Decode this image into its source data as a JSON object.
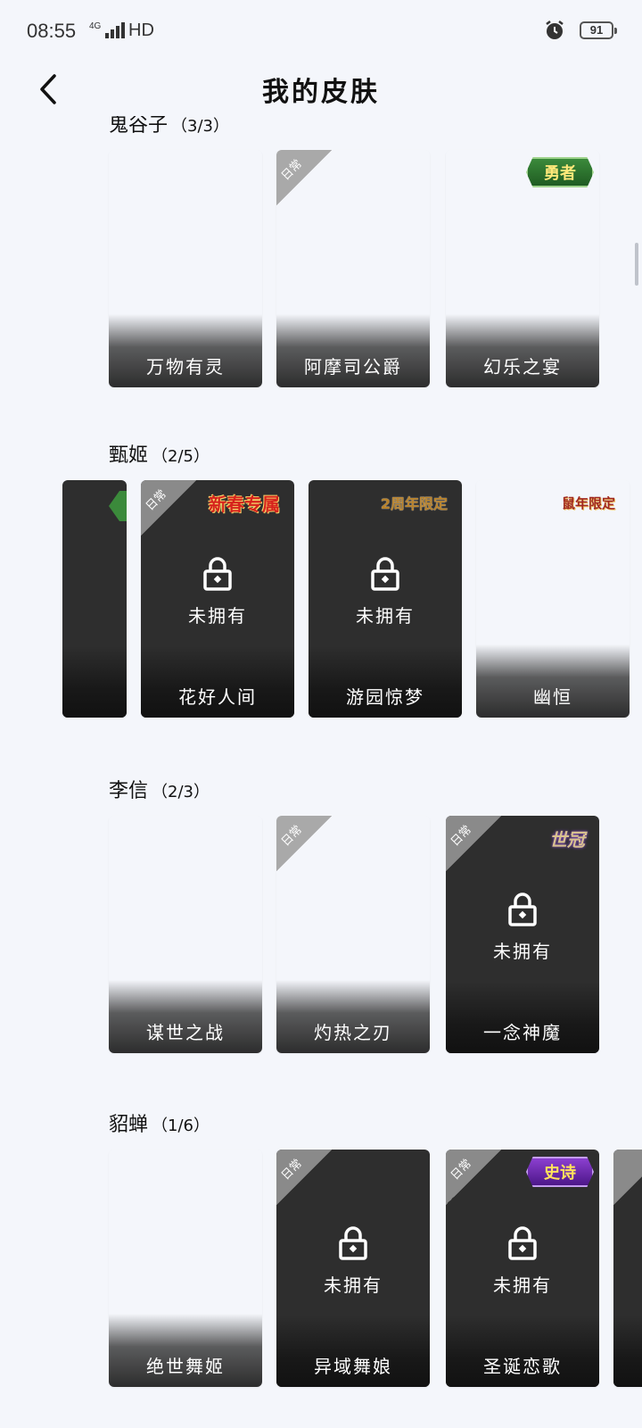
{
  "status_bar": {
    "time": "08:55",
    "network": "4G",
    "hd": "HD",
    "battery": "91"
  },
  "header": {
    "title": "我的皮肤"
  },
  "sections": [
    {
      "hero": "鬼谷子",
      "count": "（3/3）",
      "cards": [
        {
          "name": "万物有灵",
          "daily": false,
          "locked": false,
          "badge": ""
        },
        {
          "name": "阿摩司公爵",
          "daily": true,
          "locked": false,
          "badge": ""
        },
        {
          "name": "幻乐之宴",
          "daily": false,
          "locked": false,
          "badge": "勇者"
        }
      ]
    },
    {
      "hero": "甄姬",
      "count": "（2/5）",
      "cards": [
        {
          "name": "花好人间",
          "daily": true,
          "locked": true,
          "badge": "新春专属"
        },
        {
          "name": "游园惊梦",
          "daily": false,
          "locked": true,
          "badge": "2周年限定"
        },
        {
          "name": "幽恒",
          "daily": false,
          "locked": false,
          "badge": "鼠年限定"
        }
      ]
    },
    {
      "hero": "李信",
      "count": "（2/3）",
      "cards": [
        {
          "name": "谋世之战",
          "daily": false,
          "locked": false,
          "badge": ""
        },
        {
          "name": "灼热之刃",
          "daily": true,
          "locked": false,
          "badge": ""
        },
        {
          "name": "一念神魔",
          "daily": true,
          "locked": true,
          "badge": "世冠"
        }
      ]
    },
    {
      "hero": "貂蝉",
      "count": "（1/6）",
      "cards": [
        {
          "name": "绝世舞姬",
          "daily": false,
          "locked": false,
          "badge": ""
        },
        {
          "name": "异域舞娘",
          "daily": true,
          "locked": true,
          "badge": ""
        },
        {
          "name": "圣诞恋歌",
          "daily": true,
          "locked": true,
          "badge": "史诗"
        }
      ]
    }
  ],
  "labels": {
    "daily": "日常",
    "not_owned": "未拥有"
  }
}
